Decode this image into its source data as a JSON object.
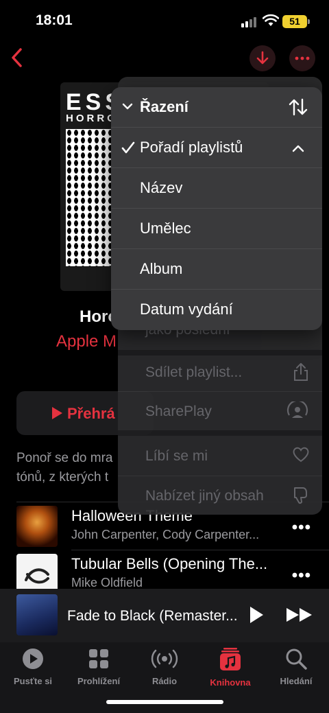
{
  "status": {
    "time": "18:01",
    "battery": "51"
  },
  "artwork": {
    "title": "ESS",
    "subtitle": "HORROR"
  },
  "playlist": {
    "title": "Horo",
    "curator": "Apple M",
    "play_label": "Přehrá",
    "description_lines": [
      "Ponoř se do mra",
      "tónů, z kterých t"
    ]
  },
  "tracks": [
    {
      "title": "Halloween Theme",
      "artist": "John Carpenter, Cody Carpenter..."
    },
    {
      "title": "Tubular Bells (Opening The...",
      "artist": "Mike Oldfield"
    }
  ],
  "mini_player": {
    "title": "Fade to Black (Remaster..."
  },
  "tabs": [
    {
      "label": "Pusťte si",
      "icon": "play-circle-icon"
    },
    {
      "label": "Prohlížení",
      "icon": "grid-icon"
    },
    {
      "label": "Rádio",
      "icon": "radio-icon"
    },
    {
      "label": "Knihovna",
      "icon": "music-library-icon",
      "active": true
    },
    {
      "label": "Hledání",
      "icon": "search-icon"
    }
  ],
  "action_menu": {
    "partial_item": "jako poslední",
    "items": [
      {
        "label": "Sdílet playlist...",
        "icon": "share-icon"
      },
      {
        "label": "SharePlay",
        "icon": "shareplay-icon"
      },
      {
        "label": "Líbí se mi",
        "icon": "heart-icon"
      },
      {
        "label": "Nabízet jiný obsah",
        "icon": "thumbs-down-icon"
      }
    ]
  },
  "sort_menu": {
    "header": "Řazení",
    "selected": "Pořadí playlistů",
    "options": [
      "Název",
      "Umělec",
      "Album",
      "Datum vydání"
    ]
  },
  "colors": {
    "accent": "#e5323f",
    "background": "#000000",
    "menu": "#3a3a3c"
  }
}
